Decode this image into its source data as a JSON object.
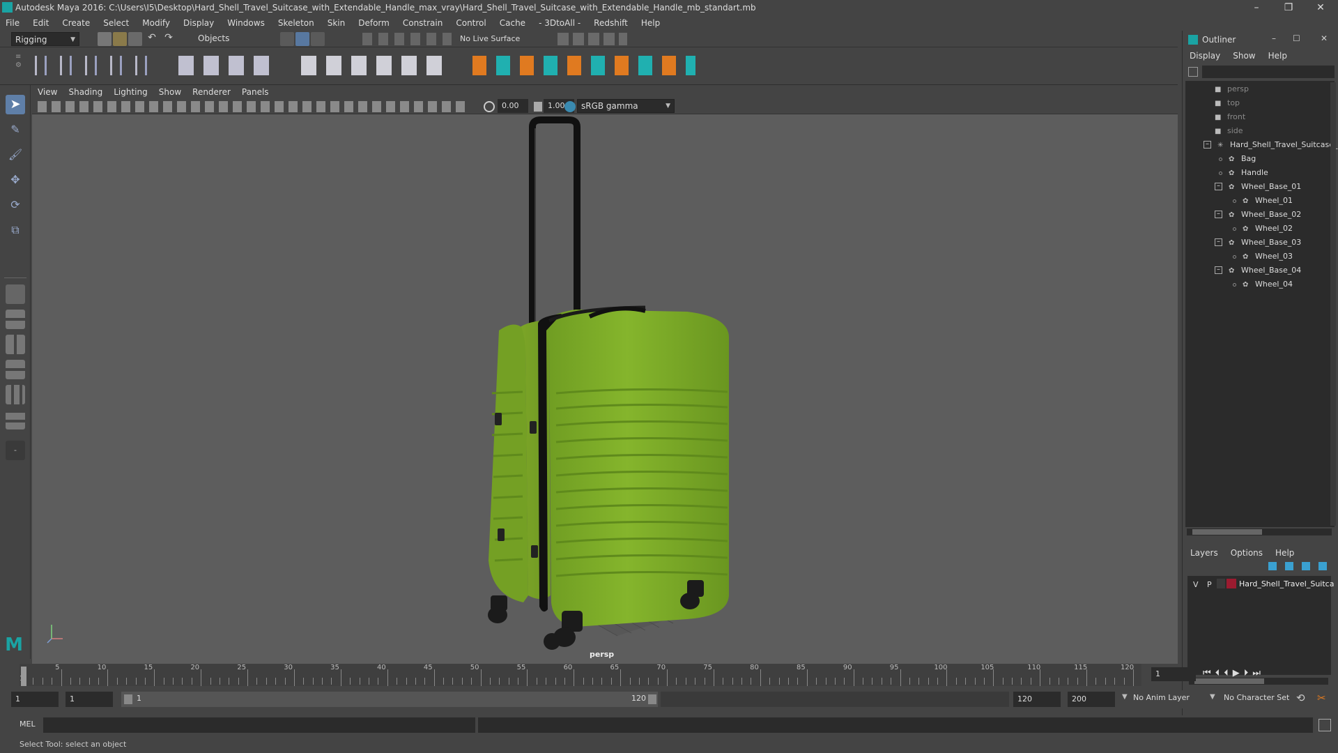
{
  "window": {
    "title": "Autodesk Maya 2016: C:\\Users\\I5\\Desktop\\Hard_Shell_Travel_Suitcase_with_Extendable_Handle_max_vray\\Hard_Shell_Travel_Suitcase_with_Extendable_Handle_mb_standart.mb",
    "minimize": "–",
    "restore": "❐",
    "close": "✕"
  },
  "menubar": [
    "File",
    "Edit",
    "Create",
    "Select",
    "Modify",
    "Display",
    "Windows",
    "Skeleton",
    "Skin",
    "Deform",
    "Constrain",
    "Control",
    "Cache",
    "- 3DtoAll -",
    "Redshift",
    "Help"
  ],
  "statusline": {
    "menuset": "Rigging",
    "selection_mask": "Objects",
    "live_surface": "No Live Surface"
  },
  "panel": {
    "menus": [
      "View",
      "Shading",
      "Lighting",
      "Show",
      "Renderer",
      "Panels"
    ],
    "exposure": "0.00",
    "gamma": "1.00",
    "color_space": "sRGB gamma"
  },
  "viewport": {
    "camera_label": "persp",
    "suitcase_color": "#7fb12a"
  },
  "outliner": {
    "title": "Outliner",
    "menus": [
      "Display",
      "Show",
      "Help"
    ],
    "items": [
      {
        "label": "persp",
        "kind": "camera",
        "depth": 0
      },
      {
        "label": "top",
        "kind": "camera",
        "depth": 0
      },
      {
        "label": "front",
        "kind": "camera",
        "depth": 0
      },
      {
        "label": "side",
        "kind": "camera",
        "depth": 0
      },
      {
        "label": "Hard_Shell_Travel_Suitcase_w",
        "kind": "group",
        "depth": 0
      },
      {
        "label": "Bag",
        "kind": "mesh",
        "depth": 1
      },
      {
        "label": "Handle",
        "kind": "mesh",
        "depth": 1
      },
      {
        "label": "Wheel_Base_01",
        "kind": "mesh",
        "depth": 1
      },
      {
        "label": "Wheel_01",
        "kind": "mesh",
        "depth": 2
      },
      {
        "label": "Wheel_Base_02",
        "kind": "mesh",
        "depth": 1
      },
      {
        "label": "Wheel_02",
        "kind": "mesh",
        "depth": 2
      },
      {
        "label": "Wheel_Base_03",
        "kind": "mesh",
        "depth": 1
      },
      {
        "label": "Wheel_03",
        "kind": "mesh",
        "depth": 2
      },
      {
        "label": "Wheel_Base_04",
        "kind": "mesh",
        "depth": 1
      },
      {
        "label": "Wheel_04",
        "kind": "mesh",
        "depth": 2
      }
    ]
  },
  "layers": {
    "menus": [
      "Layers",
      "Options",
      "Help"
    ],
    "row": {
      "v": "V",
      "p": "P",
      "name": "Hard_Shell_Travel_Suitca",
      "color": "#9b1b30"
    }
  },
  "timeline": {
    "ticks": [
      "5",
      "10",
      "15",
      "20",
      "25",
      "30",
      "35",
      "40",
      "45",
      "50",
      "55",
      "60",
      "65",
      "70",
      "75",
      "80",
      "85",
      "90",
      "95",
      "100",
      "105",
      "110",
      "115",
      "120"
    ],
    "first_tick": "1",
    "current_frame": "1"
  },
  "range": {
    "start": "1",
    "playback_start": "1",
    "slider_start": "1",
    "slider_end": "120",
    "playback_end": "120",
    "end": "200",
    "anim_layer": "No Anim Layer",
    "character_set": "No Character Set"
  },
  "cmdline": {
    "label": "MEL"
  },
  "helpline": {
    "text": "Select Tool: select an object"
  }
}
